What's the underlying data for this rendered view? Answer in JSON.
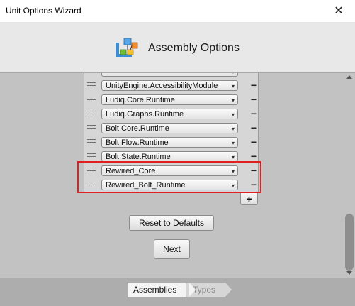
{
  "window": {
    "title": "Unit Options Wizard",
    "close_glyph": "✕"
  },
  "header": {
    "title": "Assembly Options",
    "icon": "assembly-cubes-icon"
  },
  "assemblies": {
    "rows": [
      {
        "label": "",
        "arrow": "▾"
      },
      {
        "label": "UnityEngine.AccessibilityModule",
        "arrow": "▾"
      },
      {
        "label": "Ludiq.Core.Runtime",
        "arrow": "▾"
      },
      {
        "label": "Ludiq.Graphs.Runtime",
        "arrow": "▾"
      },
      {
        "label": "Bolt.Core.Runtime",
        "arrow": "▾"
      },
      {
        "label": "Bolt.Flow.Runtime",
        "arrow": "▾"
      },
      {
        "label": "Bolt.State.Runtime",
        "arrow": "▾"
      },
      {
        "label": "Rewired_Core",
        "arrow": "▾"
      },
      {
        "label": "Rewired_Bolt_Runtime",
        "arrow": "▾"
      }
    ],
    "remove_label": "−",
    "add_label": "+"
  },
  "buttons": {
    "reset": "Reset to Defaults",
    "next": "Next"
  },
  "steps": [
    {
      "label": "Assemblies",
      "active": true
    },
    {
      "label": "Types",
      "active": false
    }
  ],
  "colors": {
    "highlight": "#e02020",
    "background": "#c2c2c2",
    "header": "#e8e8e8"
  }
}
